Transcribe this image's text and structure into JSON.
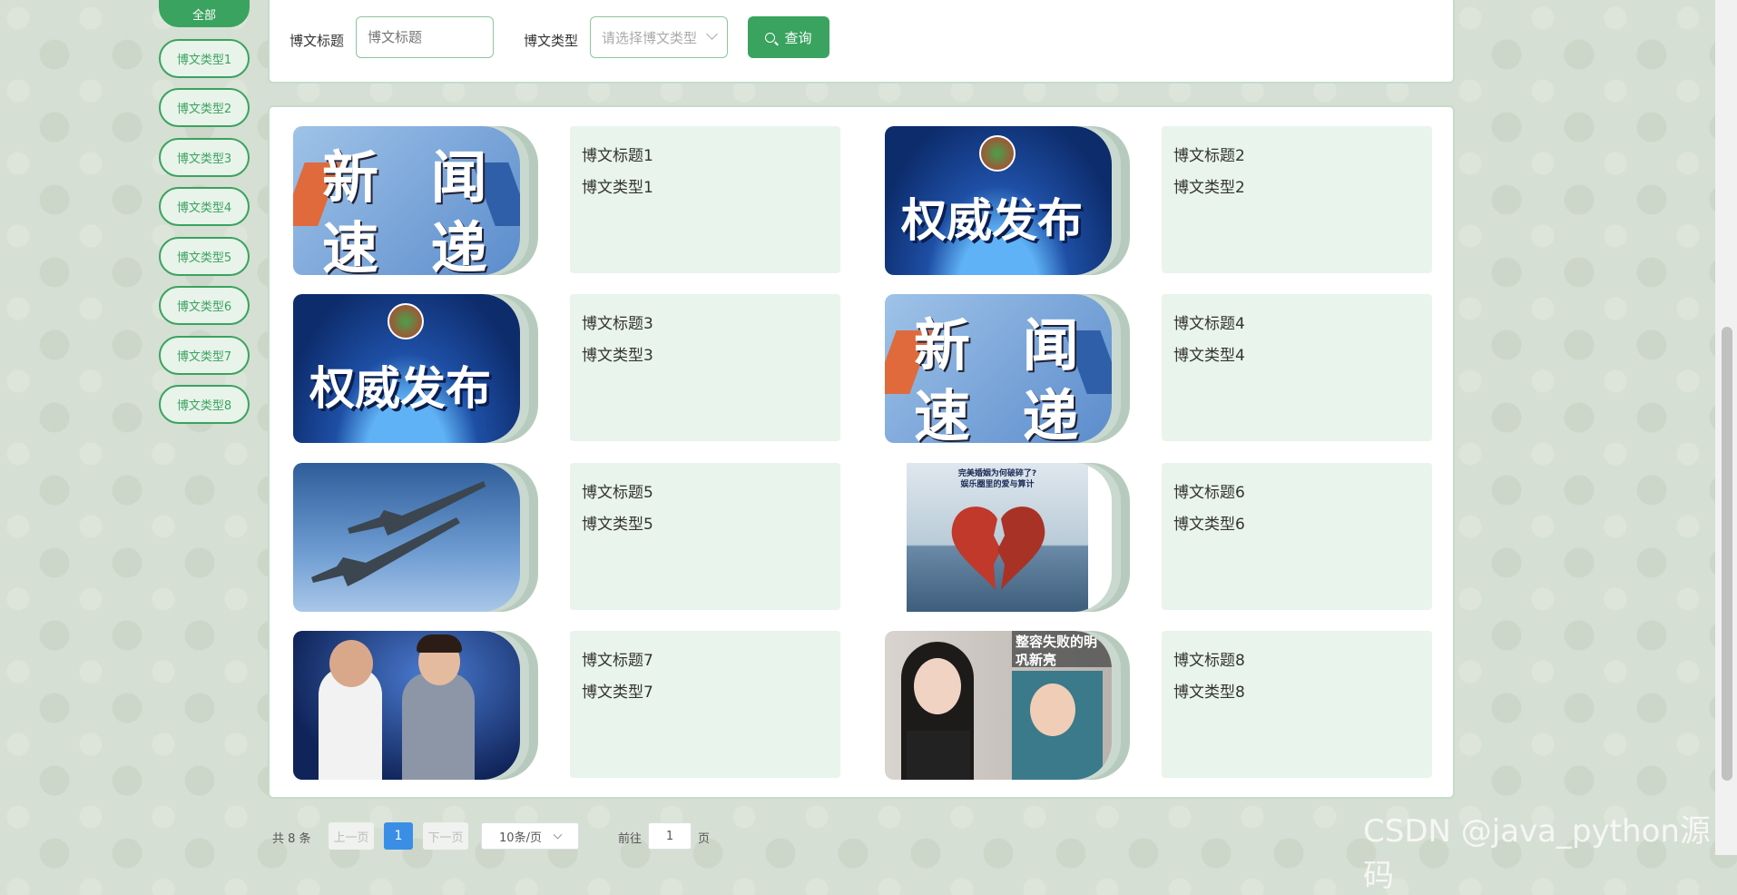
{
  "sidebar": {
    "items": [
      {
        "label": "全部",
        "active": true
      },
      {
        "label": "博文类型1"
      },
      {
        "label": "博文类型2"
      },
      {
        "label": "博文类型3"
      },
      {
        "label": "博文类型4"
      },
      {
        "label": "博文类型5"
      },
      {
        "label": "博文类型6"
      },
      {
        "label": "博文类型7"
      },
      {
        "label": "博文类型8"
      }
    ]
  },
  "search": {
    "title_label": "博文标题",
    "title_placeholder": "博文标题",
    "type_label": "博文类型",
    "type_placeholder": "请选择博文类型",
    "button_label": "查询"
  },
  "cards": [
    {
      "title": "博文标题1",
      "category": "博文类型1",
      "image": "news-express",
      "image_text": "新 闻 速 递"
    },
    {
      "title": "博文标题2",
      "category": "博文类型2",
      "image": "official-release",
      "image_text": "权威发布"
    },
    {
      "title": "博文标题3",
      "category": "博文类型3",
      "image": "official-release",
      "image_text": "权威发布"
    },
    {
      "title": "博文标题4",
      "category": "博文类型4",
      "image": "news-express",
      "image_text": "新 闻 速 递"
    },
    {
      "title": "博文标题5",
      "category": "博文类型5",
      "image": "fighter-jets"
    },
    {
      "title": "博文标题6",
      "category": "博文类型6",
      "image": "broken-heart-magazine",
      "image_text": "完美婚姻为何破碎了? 娱乐圈里的爱与算计"
    },
    {
      "title": "博文标题7",
      "category": "博文类型7",
      "image": "two-men-stage"
    },
    {
      "title": "博文标题8",
      "category": "博文类型8",
      "image": "women-portrait",
      "image_text": "整容失败的明 巩新亮"
    }
  ],
  "pagination": {
    "total": "共 8 条",
    "prev": "上一页",
    "current": "1",
    "next": "下一页",
    "page_size": "10条/页",
    "goto_label": "前往",
    "goto_value": "1",
    "goto_suffix": "页"
  },
  "watermark": "CSDN @java_python源码",
  "colors": {
    "accent": "#3aa35f",
    "card_bg": "#e9f4ec",
    "page_active": "#3a8ee6"
  }
}
